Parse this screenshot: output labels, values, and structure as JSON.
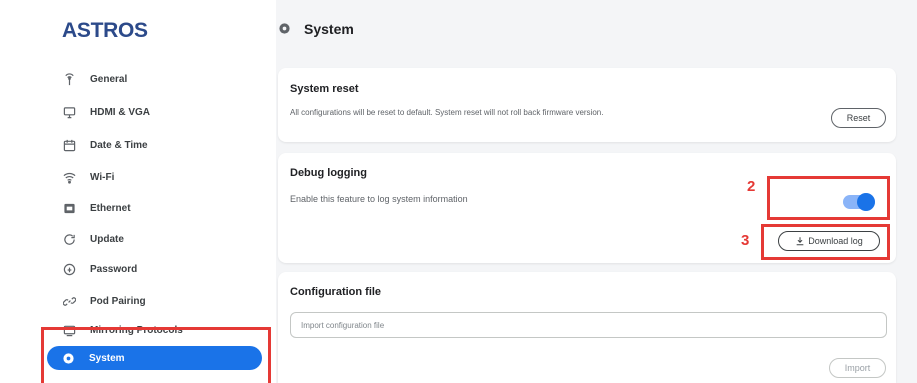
{
  "brand": "ASTROS",
  "sidebar": {
    "items": [
      {
        "label": "General",
        "icon": "antenna-icon"
      },
      {
        "label": "HDMI & VGA",
        "icon": "display-icon"
      },
      {
        "label": "Date & Time",
        "icon": "calendar-icon"
      },
      {
        "label": "Wi-Fi",
        "icon": "wifi-icon"
      },
      {
        "label": "Ethernet",
        "icon": "ethernet-icon"
      },
      {
        "label": "Update",
        "icon": "refresh-icon"
      },
      {
        "label": "Password",
        "icon": "lock-icon"
      },
      {
        "label": "Pod Pairing",
        "icon": "link-icon"
      },
      {
        "label": "Mirroring Protocols",
        "icon": "cast-icon"
      },
      {
        "label": "System",
        "icon": "gear-icon",
        "active": true
      }
    ]
  },
  "header": {
    "title": "System"
  },
  "system_reset": {
    "title": "System reset",
    "description": "All configurations will be reset to default. System reset will not roll back firmware version.",
    "button": "Reset"
  },
  "debug_logging": {
    "title": "Debug logging",
    "description": "Enable this feature to log system information",
    "toggle_on": true,
    "download_button": "Download log"
  },
  "configuration_file": {
    "title": "Configuration file",
    "placeholder": "Import configuration file",
    "button": "Import"
  },
  "annotations": {
    "toggle_number": "2",
    "download_number": "3"
  },
  "colors": {
    "accent": "#1a73e8",
    "annotation": "#e53935",
    "brand": "#2c4a8a"
  }
}
